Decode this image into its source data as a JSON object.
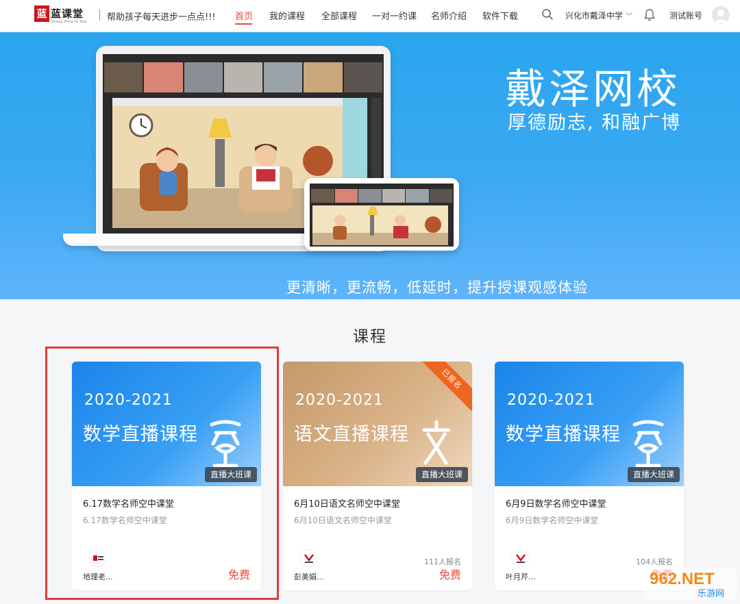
{
  "header": {
    "logo_text": "蓝课堂",
    "logo_sub": "Shuang Zheng Ke Tang",
    "slogan": "帮助孩子每天进步一点点!!!",
    "nav": [
      "首页",
      "我的课程",
      "全部课程",
      "一对一约课",
      "名师介绍",
      "软件下载"
    ],
    "active_nav": "首页",
    "school": "兴化市戴泽中学",
    "account": "测试账号",
    "accent_color": "#e94a3a"
  },
  "banner": {
    "title": "戴泽网校",
    "subtitle": "厚德励志, 和融广博",
    "caption": "更清晰，更流畅，低延时，提升授课观感体验",
    "background_color": "#2aa5ee"
  },
  "courses": {
    "section_title": "课程",
    "items": [
      {
        "cover_year": "2020-2021",
        "cover_title": "数学直播课程",
        "cover_style": "blue",
        "cover_icon": "math-glyph-icon",
        "tag": "直播大班课",
        "ribbon": "",
        "title": "6.17数学名师空中课堂",
        "subtitle": "6.17数学名师空中课堂",
        "teacher": "地理老...",
        "enrolled": "",
        "price": "免费"
      },
      {
        "cover_year": "2020-2021",
        "cover_title": "语文直播课程",
        "cover_style": "tan",
        "cover_icon": "chinese-glyph-icon",
        "tag": "直播大班课",
        "ribbon": "已报名",
        "title": "6月10日语文名师空中课堂",
        "subtitle": "6月10日语文名师空中课堂",
        "teacher": "彭美娟...",
        "enrolled": "111人报名",
        "price": "免费"
      },
      {
        "cover_year": "2020-2021",
        "cover_title": "数学直播课程",
        "cover_style": "blue",
        "cover_icon": "math-glyph-icon",
        "tag": "直播大班课",
        "ribbon": "",
        "title": "6月9日数学名师空中课堂",
        "subtitle": "6月9日数学名师空中课堂",
        "teacher": "叶月芹...",
        "enrolled": "104人报名",
        "price": "免费"
      }
    ]
  },
  "watermark": {
    "text": "962.NET",
    "sub": "乐游网"
  }
}
